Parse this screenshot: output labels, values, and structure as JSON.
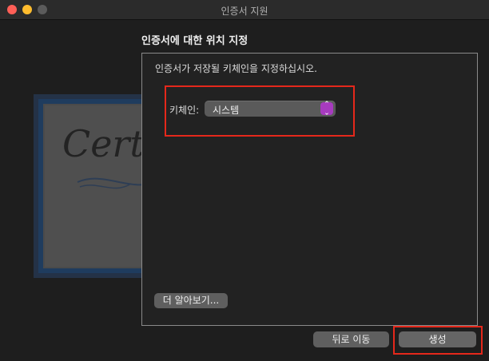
{
  "window": {
    "title": "인증서 지원"
  },
  "certificate_image": {
    "text": "Certificate"
  },
  "section_title": "인증서에 대한 위치 지정",
  "panel": {
    "instruction": "인증서가 저장될 키체인을 지정하십시오.",
    "keychain_label": "키체인:",
    "keychain_value": "시스템",
    "learn_more_label": "더 알아보기..."
  },
  "buttons": {
    "back_label": "뒤로 이동",
    "create_label": "생성"
  },
  "colors": {
    "highlight": "#e5281b",
    "stepper_accent": "#a73bbf"
  }
}
